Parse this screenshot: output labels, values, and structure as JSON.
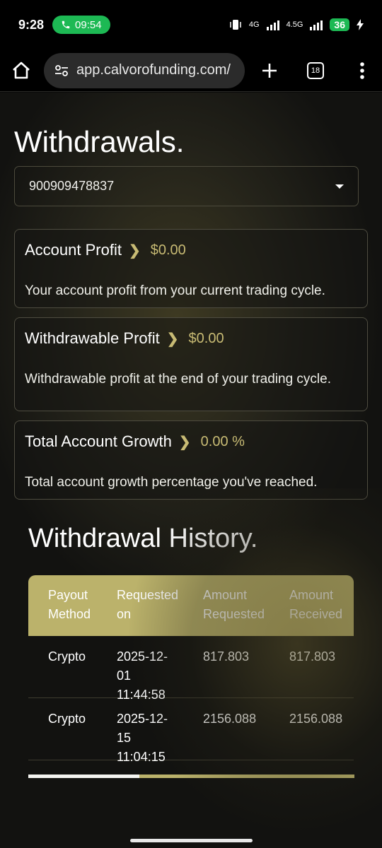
{
  "status_bar": {
    "time": "9:28",
    "call_duration": "09:54",
    "net1": "4G",
    "net2": "4.5G",
    "battery": "36"
  },
  "browser": {
    "url": "app.calvorofunding.com/",
    "tab_count": "18"
  },
  "page": {
    "title": "Withdrawals.",
    "account_select": "900909478837"
  },
  "cards": [
    {
      "title": "Account Profit",
      "value": "$0.00",
      "description": "Your account profit from your current trading cycle."
    },
    {
      "title": "Withdrawable Profit",
      "value": "$0.00",
      "description": "Withdrawable profit at the end of your trading cycle."
    },
    {
      "title": "Total Account Growth",
      "value": "0.00 %",
      "description": "Total account growth percentage you've reached."
    }
  ],
  "history": {
    "title": "Withdrawal History.",
    "columns": [
      "Payout Method",
      "Requested on",
      "Amount Requested",
      "Amount Received"
    ],
    "rows": [
      [
        "Crypto",
        "2025-12-01 11:44:58",
        "817.803",
        "817.803"
      ],
      [
        "Crypto",
        "2025-12-15 11:04:15",
        "2156.088",
        "2156.088"
      ]
    ],
    "scroll_fraction": 0.34
  },
  "colors": {
    "accent": "#bbb26b",
    "value_gold": "#c8bb74",
    "call_green": "#1db954"
  }
}
